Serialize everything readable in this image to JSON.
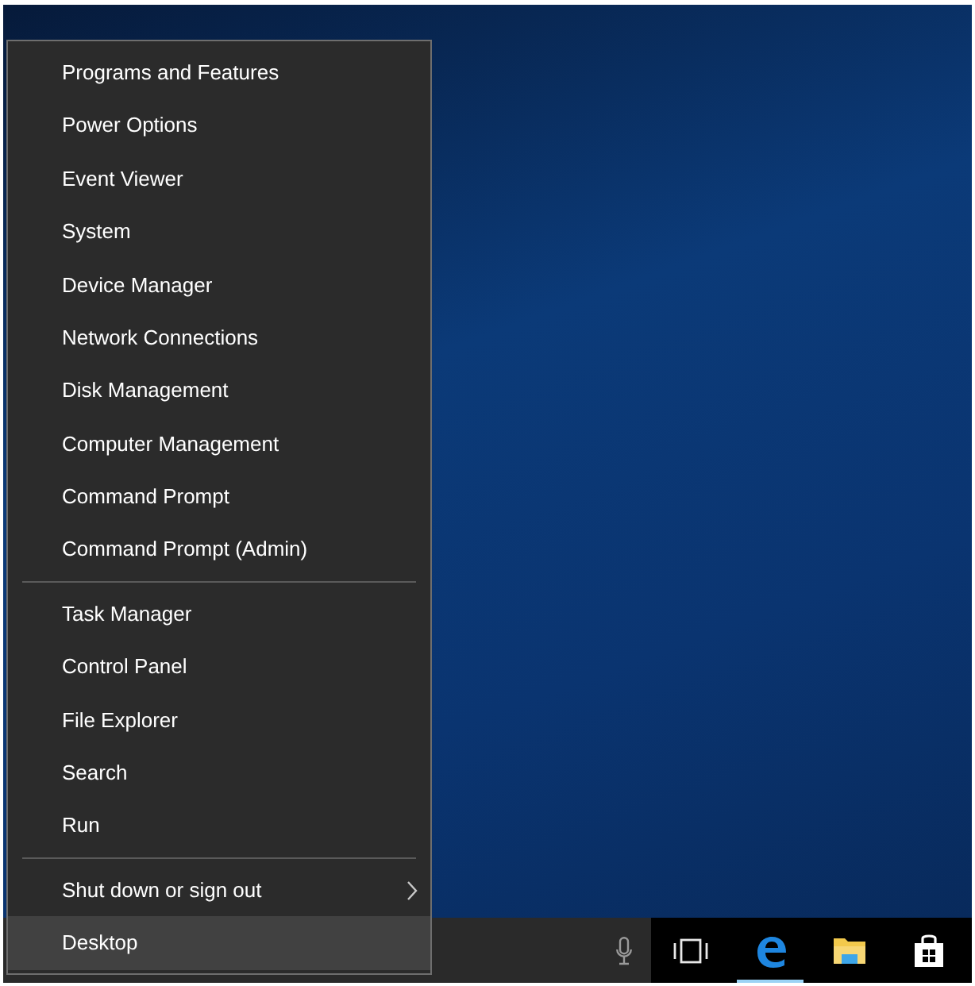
{
  "menu": {
    "groups": [
      {
        "items": [
          {
            "label": "Programs and Features",
            "selected": false
          },
          {
            "label": "Power Options",
            "selected": false
          },
          {
            "label": "Event Viewer",
            "selected": false
          },
          {
            "label": "System",
            "selected": false
          },
          {
            "label": "Device Manager",
            "selected": false
          },
          {
            "label": "Network Connections",
            "selected": false
          },
          {
            "label": "Disk Management",
            "selected": false
          },
          {
            "label": "Computer Management",
            "selected": false
          },
          {
            "label": "Command Prompt",
            "selected": false
          },
          {
            "label": "Command Prompt (Admin)",
            "selected": false
          }
        ]
      },
      {
        "items": [
          {
            "label": "Task Manager",
            "selected": false
          },
          {
            "label": "Control Panel",
            "selected": false
          },
          {
            "label": "File Explorer",
            "selected": false
          },
          {
            "label": "Search",
            "selected": false
          },
          {
            "label": "Run",
            "selected": false
          }
        ]
      },
      {
        "items": [
          {
            "label": "Shut down or sign out",
            "selected": false,
            "submenu": true
          },
          {
            "label": "Desktop",
            "selected": true,
            "submenu": false
          }
        ]
      }
    ]
  },
  "taskbar": {
    "apps": [
      {
        "kind": "taskview",
        "active": false
      },
      {
        "kind": "browser",
        "active": true
      },
      {
        "kind": "folder",
        "active": false
      },
      {
        "kind": "store",
        "active": false
      }
    ]
  }
}
